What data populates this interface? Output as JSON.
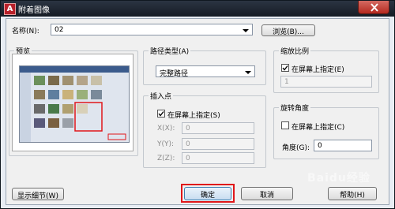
{
  "window": {
    "title": "附着图像",
    "app_icon_letter": "A"
  },
  "name_row": {
    "label": "名称(N):",
    "value": "02",
    "browse_label": "浏览(B)..."
  },
  "preview": {
    "label": "预览"
  },
  "path_type": {
    "label": "路径类型(A)",
    "value": "完整路径"
  },
  "insertion_point": {
    "label": "插入点",
    "specify_label": "在屏幕上指定(S)",
    "specify_checked": true,
    "x_label": "X(X):",
    "x_value": "0",
    "y_label": "Y(Y):",
    "y_value": "0",
    "z_label": "Z(Z):",
    "z_value": "0"
  },
  "scale": {
    "label": "缩放比例",
    "specify_label": "在屏幕上指定(E)",
    "specify_checked": true,
    "value": "1"
  },
  "rotation": {
    "label": "旋转角度",
    "specify_label": "在屏幕上指定(C)",
    "specify_checked": false,
    "angle_label": "角度(G):",
    "angle_value": "0"
  },
  "buttons": {
    "details": "显示细节(W)",
    "ok": "确定",
    "cancel": "取消",
    "help": "帮助(H)"
  },
  "watermark": "Baidu经验",
  "colors": {
    "highlight": "#e0161a",
    "titlebar": "#1e2530"
  }
}
